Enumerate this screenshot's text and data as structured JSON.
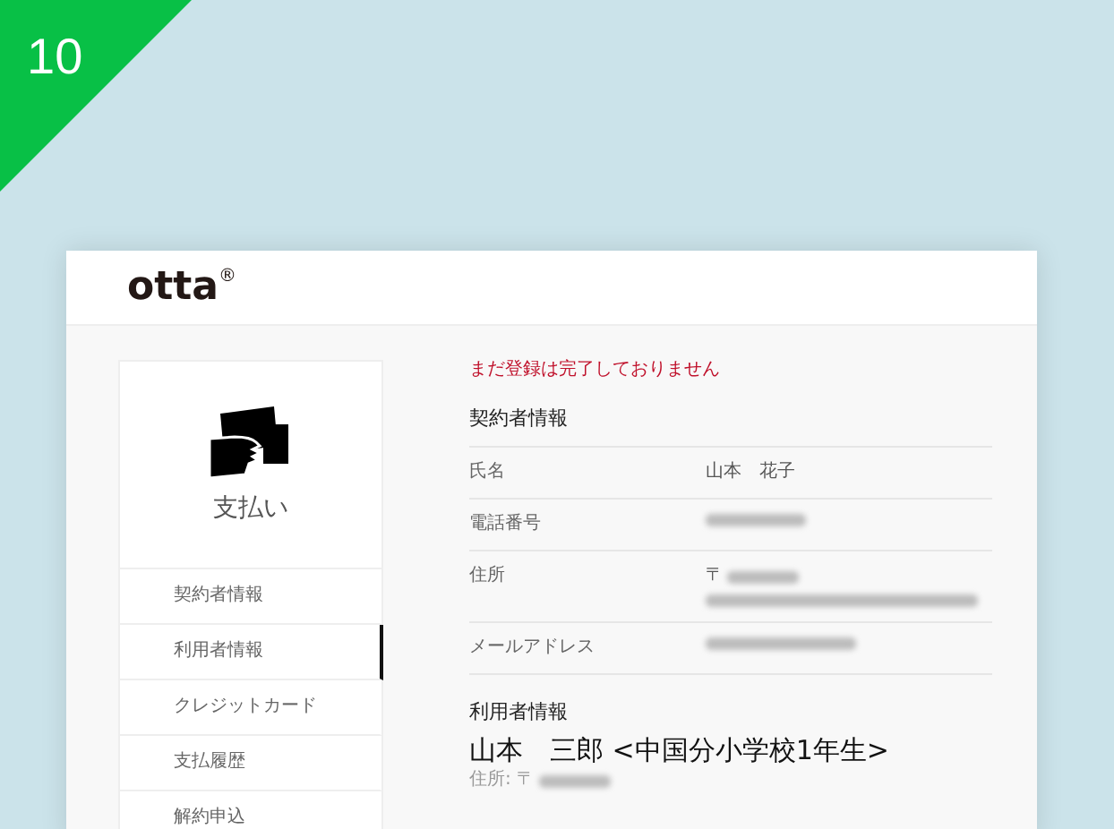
{
  "badge": "10",
  "logo": {
    "text": "otta",
    "mark": "®"
  },
  "sidebar": {
    "title": "支払い",
    "items": [
      {
        "label": "契約者情報",
        "selected": false
      },
      {
        "label": "利用者情報",
        "selected": true
      },
      {
        "label": "クレジットカード",
        "selected": false
      },
      {
        "label": "支払履歴",
        "selected": false
      },
      {
        "label": "解約申込",
        "selected": false
      }
    ]
  },
  "notice": "まだ登録は完了しておりません",
  "contract": {
    "heading": "契約者情報",
    "rows": [
      {
        "label": "氏名",
        "kind": "text",
        "value": "山本　花子"
      },
      {
        "label": "電話番号",
        "kind": "blurred"
      },
      {
        "label": "住所",
        "kind": "address",
        "value": "〒"
      },
      {
        "label": "メールアドレス",
        "kind": "blurred"
      }
    ]
  },
  "user": {
    "heading": "利用者情報",
    "name": "山本　三郎  <中国分小学校1年生>",
    "address": "住所: 〒"
  }
}
